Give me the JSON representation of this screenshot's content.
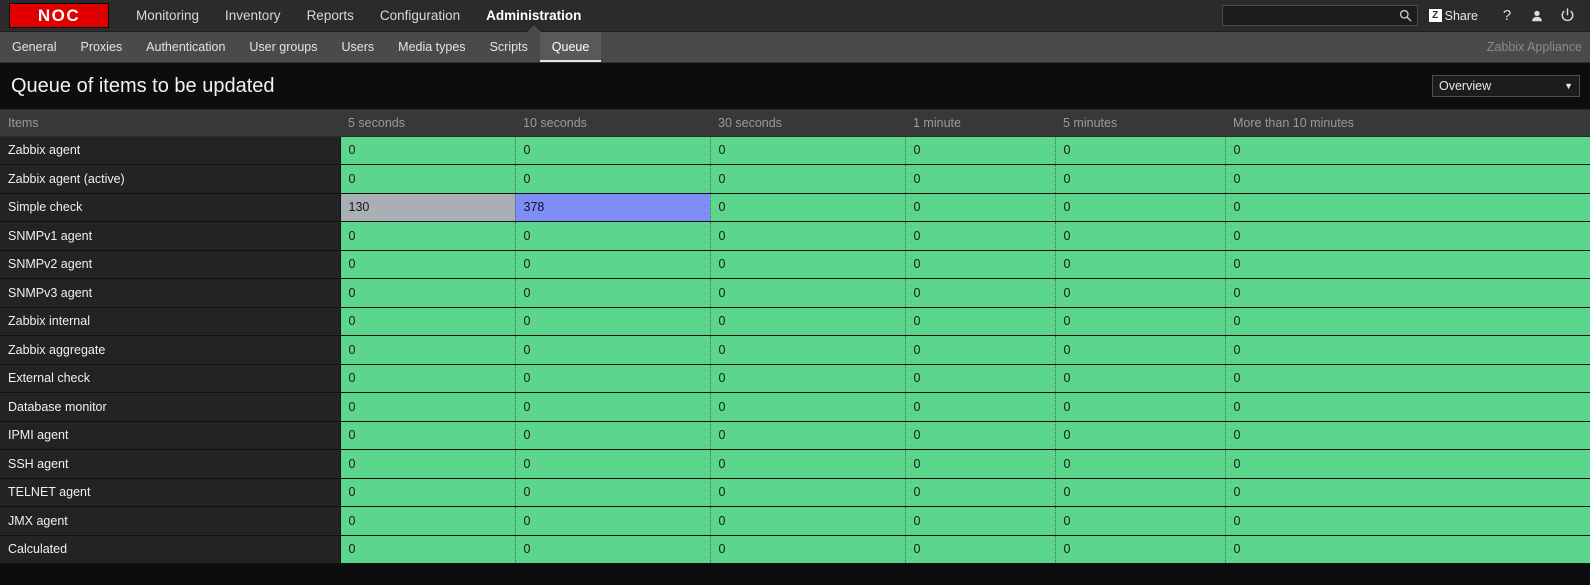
{
  "topnav": {
    "logo_text": "NOC",
    "items": [
      {
        "label": "Monitoring",
        "selected": false
      },
      {
        "label": "Inventory",
        "selected": false
      },
      {
        "label": "Reports",
        "selected": false
      },
      {
        "label": "Configuration",
        "selected": false
      },
      {
        "label": "Administration",
        "selected": true
      }
    ],
    "search": {
      "value": "",
      "placeholder": ""
    },
    "share_badge": "Z",
    "share_label": "Share",
    "help_glyph": "?"
  },
  "subnav": {
    "items": [
      {
        "label": "General",
        "selected": false
      },
      {
        "label": "Proxies",
        "selected": false
      },
      {
        "label": "Authentication",
        "selected": false
      },
      {
        "label": "User groups",
        "selected": false
      },
      {
        "label": "Users",
        "selected": false
      },
      {
        "label": "Media types",
        "selected": false
      },
      {
        "label": "Scripts",
        "selected": false
      },
      {
        "label": "Queue",
        "selected": true
      }
    ],
    "appliance_label": "Zabbix Appliance"
  },
  "page": {
    "title": "Queue of items to be updated",
    "view_select": {
      "value": "Overview",
      "caret": "▼"
    }
  },
  "table": {
    "columns": [
      "Items",
      "5 seconds",
      "10 seconds",
      "30 seconds",
      "1 minute",
      "5 minutes",
      "More than 10 minutes"
    ],
    "rows": [
      {
        "name": "Zabbix agent",
        "cells": [
          {
            "v": "0",
            "s": "green"
          },
          {
            "v": "0",
            "s": "green"
          },
          {
            "v": "0",
            "s": "green"
          },
          {
            "v": "0",
            "s": "green"
          },
          {
            "v": "0",
            "s": "green"
          },
          {
            "v": "0",
            "s": "green"
          }
        ]
      },
      {
        "name": "Zabbix agent (active)",
        "cells": [
          {
            "v": "0",
            "s": "green"
          },
          {
            "v": "0",
            "s": "green"
          },
          {
            "v": "0",
            "s": "green"
          },
          {
            "v": "0",
            "s": "green"
          },
          {
            "v": "0",
            "s": "green"
          },
          {
            "v": "0",
            "s": "green"
          }
        ]
      },
      {
        "name": "Simple check",
        "cells": [
          {
            "v": "130",
            "s": "grey"
          },
          {
            "v": "378",
            "s": "blue"
          },
          {
            "v": "0",
            "s": "green"
          },
          {
            "v": "0",
            "s": "green"
          },
          {
            "v": "0",
            "s": "green"
          },
          {
            "v": "0",
            "s": "green"
          }
        ]
      },
      {
        "name": "SNMPv1 agent",
        "cells": [
          {
            "v": "0",
            "s": "green"
          },
          {
            "v": "0",
            "s": "green"
          },
          {
            "v": "0",
            "s": "green"
          },
          {
            "v": "0",
            "s": "green"
          },
          {
            "v": "0",
            "s": "green"
          },
          {
            "v": "0",
            "s": "green"
          }
        ]
      },
      {
        "name": "SNMPv2 agent",
        "cells": [
          {
            "v": "0",
            "s": "green"
          },
          {
            "v": "0",
            "s": "green"
          },
          {
            "v": "0",
            "s": "green"
          },
          {
            "v": "0",
            "s": "green"
          },
          {
            "v": "0",
            "s": "green"
          },
          {
            "v": "0",
            "s": "green"
          }
        ]
      },
      {
        "name": "SNMPv3 agent",
        "cells": [
          {
            "v": "0",
            "s": "green"
          },
          {
            "v": "0",
            "s": "green"
          },
          {
            "v": "0",
            "s": "green"
          },
          {
            "v": "0",
            "s": "green"
          },
          {
            "v": "0",
            "s": "green"
          },
          {
            "v": "0",
            "s": "green"
          }
        ]
      },
      {
        "name": "Zabbix internal",
        "cells": [
          {
            "v": "0",
            "s": "green"
          },
          {
            "v": "0",
            "s": "green"
          },
          {
            "v": "0",
            "s": "green"
          },
          {
            "v": "0",
            "s": "green"
          },
          {
            "v": "0",
            "s": "green"
          },
          {
            "v": "0",
            "s": "green"
          }
        ]
      },
      {
        "name": "Zabbix aggregate",
        "cells": [
          {
            "v": "0",
            "s": "green"
          },
          {
            "v": "0",
            "s": "green"
          },
          {
            "v": "0",
            "s": "green"
          },
          {
            "v": "0",
            "s": "green"
          },
          {
            "v": "0",
            "s": "green"
          },
          {
            "v": "0",
            "s": "green"
          }
        ]
      },
      {
        "name": "External check",
        "cells": [
          {
            "v": "0",
            "s": "green"
          },
          {
            "v": "0",
            "s": "green"
          },
          {
            "v": "0",
            "s": "green"
          },
          {
            "v": "0",
            "s": "green"
          },
          {
            "v": "0",
            "s": "green"
          },
          {
            "v": "0",
            "s": "green"
          }
        ]
      },
      {
        "name": "Database monitor",
        "cells": [
          {
            "v": "0",
            "s": "green"
          },
          {
            "v": "0",
            "s": "green"
          },
          {
            "v": "0",
            "s": "green"
          },
          {
            "v": "0",
            "s": "green"
          },
          {
            "v": "0",
            "s": "green"
          },
          {
            "v": "0",
            "s": "green"
          }
        ]
      },
      {
        "name": "IPMI agent",
        "cells": [
          {
            "v": "0",
            "s": "green"
          },
          {
            "v": "0",
            "s": "green"
          },
          {
            "v": "0",
            "s": "green"
          },
          {
            "v": "0",
            "s": "green"
          },
          {
            "v": "0",
            "s": "green"
          },
          {
            "v": "0",
            "s": "green"
          }
        ]
      },
      {
        "name": "SSH agent",
        "cells": [
          {
            "v": "0",
            "s": "green"
          },
          {
            "v": "0",
            "s": "green"
          },
          {
            "v": "0",
            "s": "green"
          },
          {
            "v": "0",
            "s": "green"
          },
          {
            "v": "0",
            "s": "green"
          },
          {
            "v": "0",
            "s": "green"
          }
        ]
      },
      {
        "name": "TELNET agent",
        "cells": [
          {
            "v": "0",
            "s": "green"
          },
          {
            "v": "0",
            "s": "green"
          },
          {
            "v": "0",
            "s": "green"
          },
          {
            "v": "0",
            "s": "green"
          },
          {
            "v": "0",
            "s": "green"
          },
          {
            "v": "0",
            "s": "green"
          }
        ]
      },
      {
        "name": "JMX agent",
        "cells": [
          {
            "v": "0",
            "s": "green"
          },
          {
            "v": "0",
            "s": "green"
          },
          {
            "v": "0",
            "s": "green"
          },
          {
            "v": "0",
            "s": "green"
          },
          {
            "v": "0",
            "s": "green"
          },
          {
            "v": "0",
            "s": "green"
          }
        ]
      },
      {
        "name": "Calculated",
        "cells": [
          {
            "v": "0",
            "s": "green"
          },
          {
            "v": "0",
            "s": "green"
          },
          {
            "v": "0",
            "s": "green"
          },
          {
            "v": "0",
            "s": "green"
          },
          {
            "v": "0",
            "s": "green"
          },
          {
            "v": "0",
            "s": "green"
          }
        ]
      }
    ]
  },
  "colors": {
    "brand_red": "#e00000",
    "ok_green": "#5cd68d",
    "warn_grey": "#a9afb5",
    "alert_blue": "#7f8df7"
  }
}
